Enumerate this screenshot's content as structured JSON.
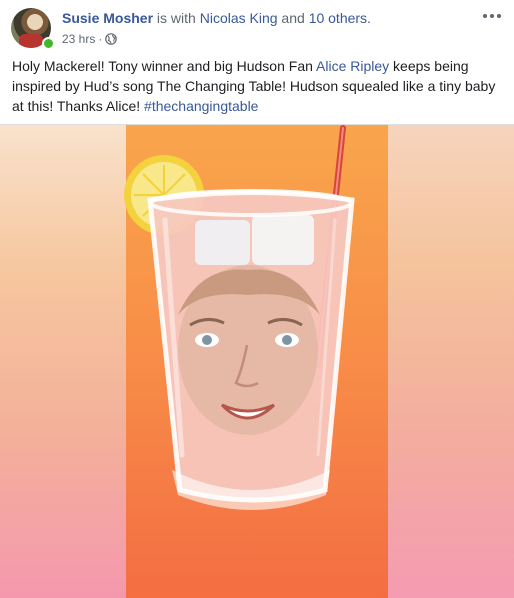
{
  "post": {
    "author": "Susie Mosher",
    "with_text": " is with ",
    "tagged": "Nicolas King",
    "and_text": " and ",
    "others": "10 others.",
    "time": "23 hrs",
    "sep": "·",
    "privacy_icon": "globe-icon",
    "more_icon": "more-options-icon"
  },
  "text": {
    "part1": "Holy Mackerel! Tony winner and big Hudson Fan ",
    "mention": "Alice Ripley",
    "part2": " keeps being inspired by Hud’s song The Changing Table! Hudson squealed like a tiny baby at this! Thanks Alice! ",
    "hashtag": "#thechangingtable"
  },
  "media": {
    "type": "video",
    "description_icon": "video-frame"
  },
  "colors": {
    "link": "#385898",
    "text": "#1c1e21",
    "meta": "#606770",
    "online": "#42b72a",
    "video_bg": "#f88f48"
  }
}
